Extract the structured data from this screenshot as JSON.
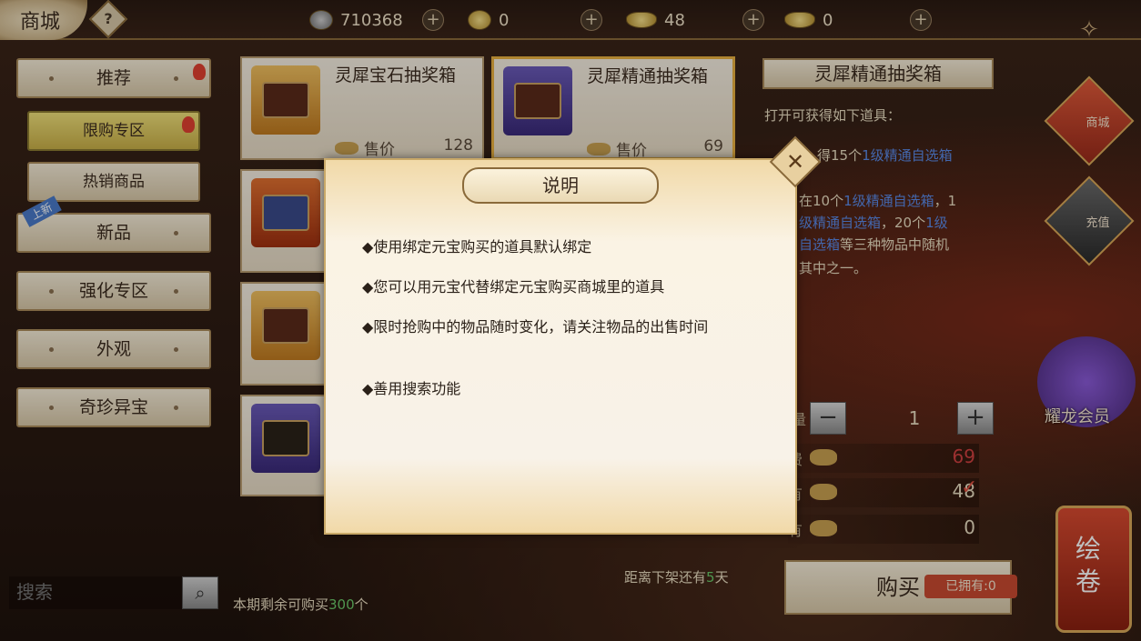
{
  "header": {
    "title": "商城",
    "help": "?",
    "currencies": [
      {
        "icon": "copper-coin-icon",
        "value": "710368"
      },
      {
        "icon": "gold-coin-icon",
        "value": "0"
      },
      {
        "icon": "ingot-icon",
        "value": "48"
      },
      {
        "icon": "bound-ingot-icon",
        "value": "0"
      }
    ],
    "plus": "+"
  },
  "sidebar": {
    "items": [
      {
        "label": "推荐"
      },
      {
        "label": "限购专区"
      },
      {
        "label": "热销商品"
      },
      {
        "label": "新品",
        "badge": "上新"
      },
      {
        "label": "强化专区"
      },
      {
        "label": "外观"
      },
      {
        "label": "奇珍异宝"
      }
    ]
  },
  "products": [
    {
      "name": "灵犀宝石抽奖箱",
      "price_label": "售价",
      "price": "128"
    },
    {
      "name": "灵犀精通抽奖箱",
      "price_label": "售价",
      "price": "69"
    }
  ],
  "detail": {
    "title": "灵犀精通抽奖箱",
    "intro": "打开可获得如下道具：",
    "line1_a": "得15个",
    "line1_hl": "1级精通自选箱",
    "line2_a": "在10个",
    "line2_hl": "1级精通自选箱",
    "line2_b": "，1",
    "line3_hl": "级精通自选箱",
    "line3_a": "，20个",
    "line3_hl2": "1级",
    "line4_hl": "自选箱",
    "line4_a": "等三种物品中随机",
    "line5": "其中之一。",
    "qty_label": "量",
    "qty": "1",
    "minus": "−",
    "plus": "+",
    "cost_label": "费",
    "cost": "69",
    "have_label": "有",
    "have": "48",
    "have2_label": "有",
    "have2": "0",
    "check": "✓"
  },
  "footer": {
    "search_placeholder": "搜索",
    "remaining_a": "本期剩余可购买",
    "remaining_num": "300",
    "remaining_b": "个",
    "countdown_a": "距离下架还有",
    "countdown_num": "5",
    "countdown_b": "天",
    "buy": "购买",
    "owned": "已拥有:0"
  },
  "rail": {
    "shop": "商城",
    "pay": "充值",
    "vip": "耀龙会员",
    "scroll": "绘卷"
  },
  "dialog": {
    "title": "说明",
    "close": "✕",
    "rules": [
      "◆使用绑定元宝购买的道具默认绑定",
      "◆您可以用元宝代替绑定元宝购买商城里的道具",
      "◆限时抢购中的物品随时变化，请关注物品的出售时间",
      "◆善用搜索功能"
    ]
  }
}
